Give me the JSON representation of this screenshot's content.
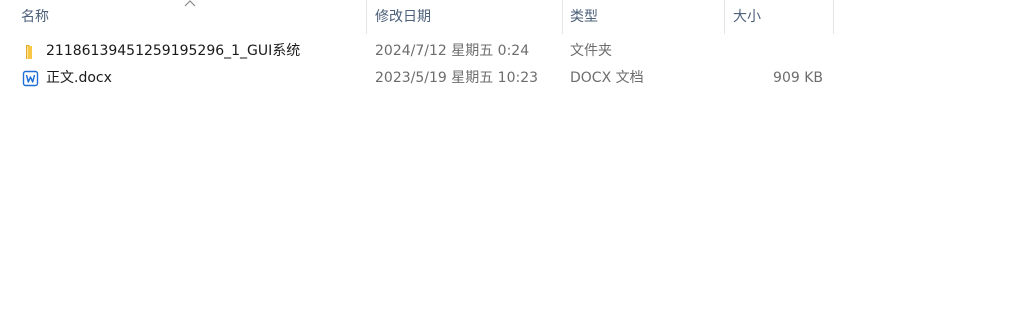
{
  "header": {
    "columns": [
      {
        "label": "名称"
      },
      {
        "label": "修改日期"
      },
      {
        "label": "类型"
      },
      {
        "label": "大小"
      }
    ],
    "sort_icon": "chevron-up-icon"
  },
  "files": [
    {
      "icon": "folder-icon",
      "name": "21186139451259195296_1_GUI系统",
      "modified": "2024/7/12 星期五 0:24",
      "type": "文件夹",
      "size": ""
    },
    {
      "icon": "word-document-icon",
      "name": "正文.docx",
      "modified": "2023/5/19 星期五 10:23",
      "type": "DOCX 文档",
      "size": "909 KB"
    }
  ],
  "colors": {
    "folder": "#f8c745",
    "word_blue": "#1f6fd6",
    "header_text": "#4c607a"
  }
}
